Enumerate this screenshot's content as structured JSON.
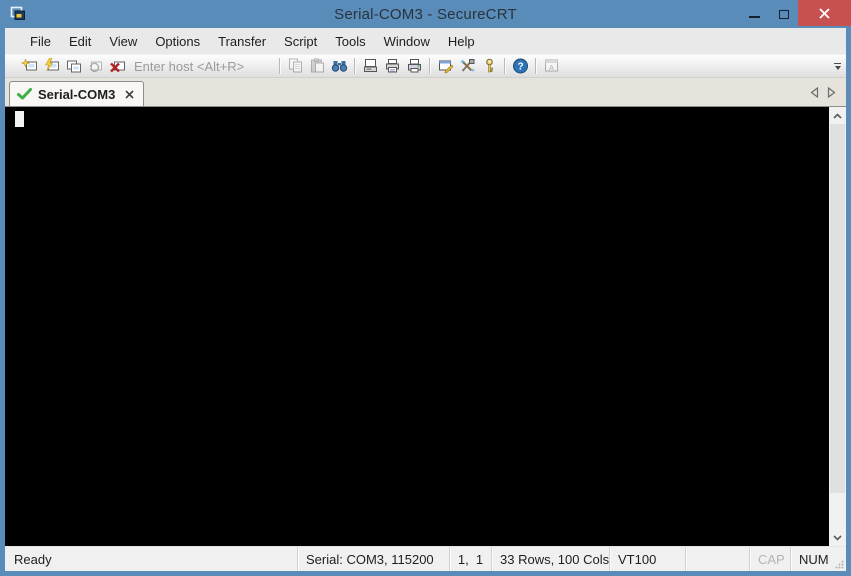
{
  "window": {
    "title": "Serial-COM3 - SecureCRT",
    "control_icons": [
      "minimize-icon",
      "maximize-icon",
      "close-icon"
    ]
  },
  "menu": {
    "items": [
      "File",
      "Edit",
      "View",
      "Options",
      "Transfer",
      "Script",
      "Tools",
      "Window",
      "Help"
    ]
  },
  "toolbar": {
    "quick_connect_placeholder": "Enter host <Alt+R>",
    "button_icons": [
      "connect-icon",
      "quick-connect-icon",
      "connect-in-tab-icon",
      "reconnect-icon",
      "disconnect-icon",
      "copy-icon",
      "paste-icon",
      "find-icon",
      "print-screen-icon",
      "print-setup-icon",
      "print-icon",
      "session-options-icon",
      "global-options-icon",
      "key-generator-icon",
      "help-icon",
      "file-transfer-icon",
      "toolbar-overflow-icon"
    ],
    "disabled_buttons": [
      "reconnect",
      "copy",
      "paste",
      "file-transfer"
    ]
  },
  "tabbar": {
    "tabs": [
      {
        "label": "Serial-COM3",
        "status_icon": "connected-check-icon",
        "active": true
      }
    ],
    "nav_icons": [
      "scroll-tabs-left-icon",
      "scroll-tabs-right-icon"
    ]
  },
  "terminal": {
    "content": "",
    "cursor": "block"
  },
  "statusbar": {
    "ready": "Ready",
    "connection": "Serial: COM3, 115200",
    "cursor_pos": "1,  1",
    "grid": "33 Rows, 100 Cols",
    "emulation": "VT100",
    "caps_indicator": "CAP",
    "num_indicator": "NUM"
  },
  "colors": {
    "titlebar_blue": "#5a8cba",
    "close_red": "#c75050",
    "terminal_bg": "#000000",
    "tab_check_green": "#3fae47",
    "chrome_gray": "#e9e9e9"
  }
}
